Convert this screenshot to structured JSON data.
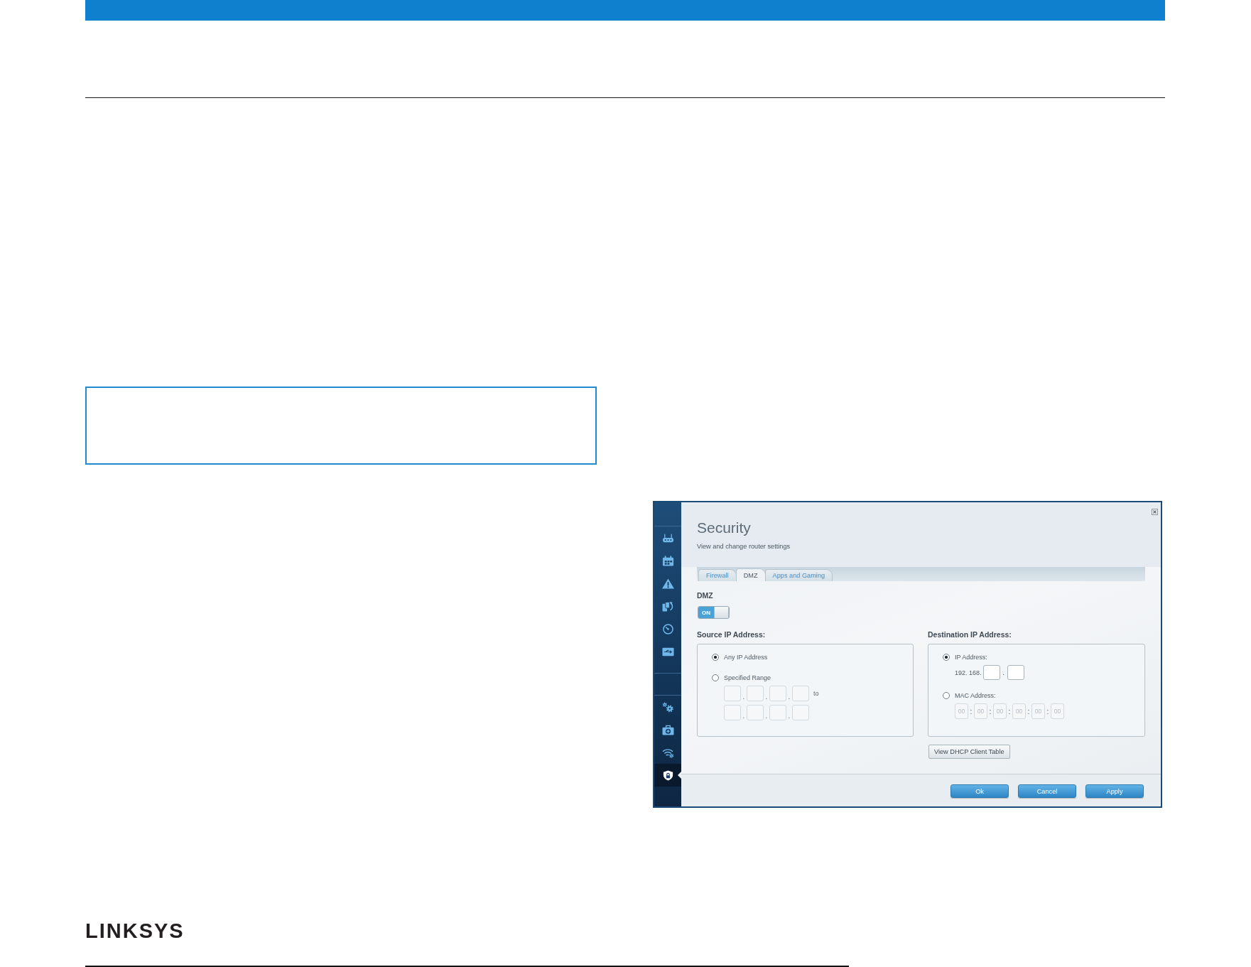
{
  "screenshot": {
    "sidebar": {
      "groups": [
        {
          "items": [
            {
              "selected": false
            },
            {
              "selected": false
            },
            {
              "selected": false
            },
            {
              "selected": false
            },
            {
              "selected": false
            },
            {
              "selected": false
            }
          ]
        },
        {
          "items": [
            {
              "selected": false
            },
            {
              "selected": false
            },
            {
              "selected": false
            },
            {
              "selected": true
            }
          ]
        }
      ]
    },
    "title": "Security",
    "subtitle": "View and change router settings",
    "tabs": [
      {
        "label": "Firewall",
        "selected": false
      },
      {
        "label": "DMZ",
        "selected": true
      },
      {
        "label": "Apps and Gaming",
        "selected": false
      }
    ],
    "dmz": {
      "label": "DMZ",
      "toggle": {
        "on": true,
        "label": "ON"
      }
    },
    "source": {
      "heading": "Source IP Address:",
      "options": [
        {
          "kind": "any",
          "label": "Any IP Address",
          "selected": true
        },
        {
          "kind": "range",
          "label": "Specified Range",
          "selected": false,
          "rows": [
            {
              "separators": [
                ".",
                ".",
                "."
              ],
              "suffix": "to"
            },
            {
              "separators": [
                ".",
                ".",
                "."
              ]
            }
          ]
        }
      ]
    },
    "destination": {
      "heading": "Destination IP Address:",
      "options": [
        {
          "kind": "ip",
          "label": "IP Address:",
          "selected": true,
          "prefix": "192. 168.",
          "separators": [
            "."
          ]
        },
        {
          "kind": "mac",
          "label": "MAC Address:",
          "selected": false,
          "fields": [
            {
              "placeholder": "00"
            },
            {
              "placeholder": "00"
            },
            {
              "placeholder": "00"
            },
            {
              "placeholder": "00"
            },
            {
              "placeholder": "00"
            },
            {
              "placeholder": "00"
            }
          ],
          "separators": [
            ":",
            ":",
            ":",
            ":",
            ":"
          ]
        }
      ],
      "table_button": "View DHCP Client Table"
    },
    "footer_buttons": [
      {
        "label": "Ok"
      },
      {
        "label": "Cancel"
      },
      {
        "label": "Apply"
      }
    ]
  },
  "footer": {
    "logo": "LINKSYS"
  }
}
